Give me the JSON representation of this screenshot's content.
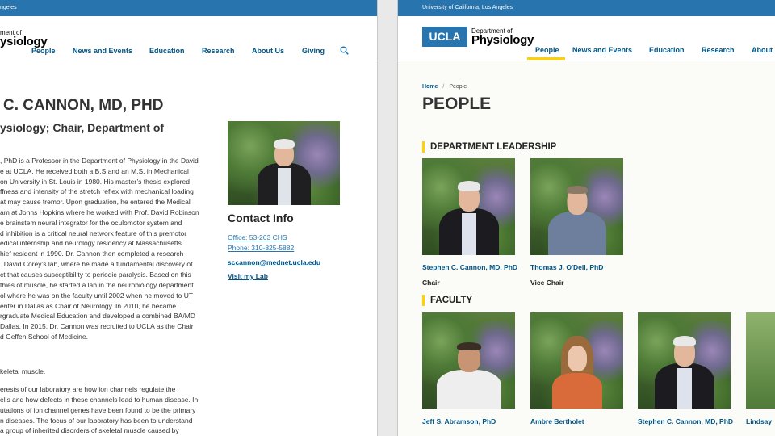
{
  "left": {
    "nav": [
      "People",
      "News and Events",
      "Education",
      "Research",
      "About Us",
      "Giving"
    ],
    "logo_partial": "ysiology",
    "logo_dept_partial": "ment of",
    "topbar_partial": "ngeles",
    "name_heading": "C. CANNON, MD, PHD",
    "title_line": "ysiology; Chair, Department of",
    "bio_lines": [
      ", PhD is a Professor in the Department of Physiology in the David",
      "e at UCLA. He received both a B.S and an M.S. in Mechanical",
      "on University in St. Louis in 1980. His master’s thesis explored",
      "ffness and intensity of the stretch reflex with mechanical loading",
      "at may cause tremor. Upon graduation, he entered the Medical",
      "am at Johns Hopkins where he worked with Prof. David Robinson",
      "e brainstem neural integrator for the oculomotor system and",
      "d inhibition is a critical neural network feature of this premotor",
      "edical internship and neurology residency at Massachusetts",
      "hief resident in 1990. Dr. Cannon then completed a research",
      ". David Corey’s lab, where he made a fundamental discovery of",
      "ct that causes susceptibility to periodic paralysis. Based on this",
      "thies of muscle, he started a lab in the neurobiology department",
      "ol where he was on the faculty until 2002 when he moved to UT",
      "enter in Dallas as Chair of Neurology. In 2010, he became",
      "rgraduate Medical Education and developed a combined BA/MD",
      "Dallas. In 2015, Dr. Cannon was recruited to UCLA as the Chair",
      "d Geffen School of Medicine."
    ],
    "short_line": "keletal muscle.",
    "research_lines": [
      "erests of our laboratory are how ion channels regulate the",
      "ells and how defects in these channels lead to human disease. In",
      "utations of ion channel genes have been found to be the primary",
      "n diseases. The focus of our laboratory has been to understand",
      "a group of inherited disorders of skeletal muscle caused by"
    ],
    "contact": {
      "heading": "Contact Info",
      "office": "Office: 53-263 CHS",
      "phone": "Phone: 310-825-5882",
      "email": "sccannon@mednet.ucla.edu",
      "lab": "Visit my Lab"
    }
  },
  "right": {
    "topbar": "University of California, Los Angeles",
    "logo_ucla": "UCLA",
    "logo_dept": "Department of",
    "logo_phys": "Physiology",
    "nav": [
      "People",
      "News and Events",
      "Education",
      "Research",
      "About"
    ],
    "active_nav": "People",
    "breadcrumb": {
      "home": "Home",
      "sep": "/",
      "current": "People"
    },
    "page_title": "PEOPLE",
    "section_leadership": "DEPARTMENT LEADERSHIP",
    "leadership": [
      {
        "name": "Stephen C. Cannon, MD, PhD",
        "role": "Chair"
      },
      {
        "name": "Thomas J. O'Dell, PhD",
        "role": "Vice Chair"
      }
    ],
    "section_faculty": "FACULTY",
    "faculty": [
      {
        "name": "Jeff S. Abramson, PhD"
      },
      {
        "name": "Ambre Bertholet"
      },
      {
        "name": "Stephen C. Cannon, MD, PhD"
      },
      {
        "name": "Lindsay"
      }
    ]
  },
  "colors": {
    "ucla_blue": "#2774ae",
    "link": "#005587",
    "accent": "#ffd100"
  }
}
